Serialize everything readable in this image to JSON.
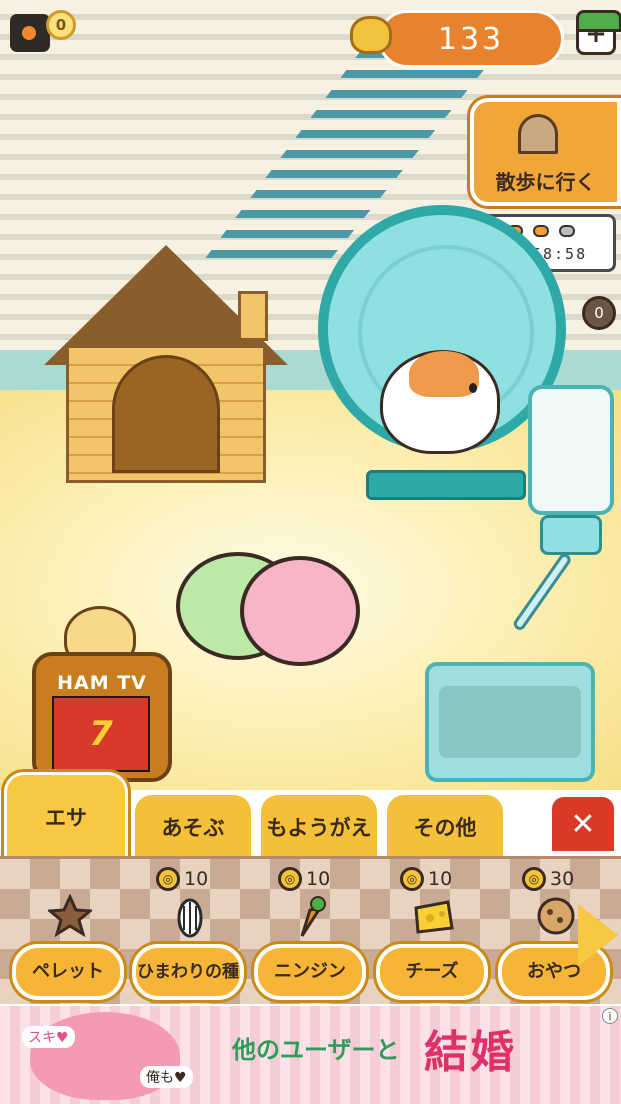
{
  "hud": {
    "camera_coin": "0",
    "coins": "133",
    "plus": "+"
  },
  "walk": {
    "label": "散歩に行く"
  },
  "timer": {
    "time": "01:58:58",
    "badge": "0"
  },
  "tv": {
    "label": "HAM TV",
    "screen": "7"
  },
  "tabs": [
    {
      "label": "エサ"
    },
    {
      "label": "あそぶ"
    },
    {
      "label": "もようがえ"
    },
    {
      "label": "その他"
    }
  ],
  "close_glyph": "✕",
  "food": [
    {
      "name": "ペレット",
      "cost": "",
      "icon": "pellet-icon"
    },
    {
      "name": "ひまわりの種",
      "cost": "10",
      "icon": "sunflower-seed-icon"
    },
    {
      "name": "ニンジン",
      "cost": "10",
      "icon": "carrot-icon"
    },
    {
      "name": "チーズ",
      "cost": "10",
      "icon": "cheese-icon"
    },
    {
      "name": "おやつ",
      "cost": "30",
      "icon": "cookie-icon"
    }
  ],
  "coin_glyph": "◎",
  "ad": {
    "tag1": "スキ♥",
    "tag2": "俺も♥",
    "line1": "他のユーザーと",
    "line2": "結婚",
    "info": "i"
  }
}
